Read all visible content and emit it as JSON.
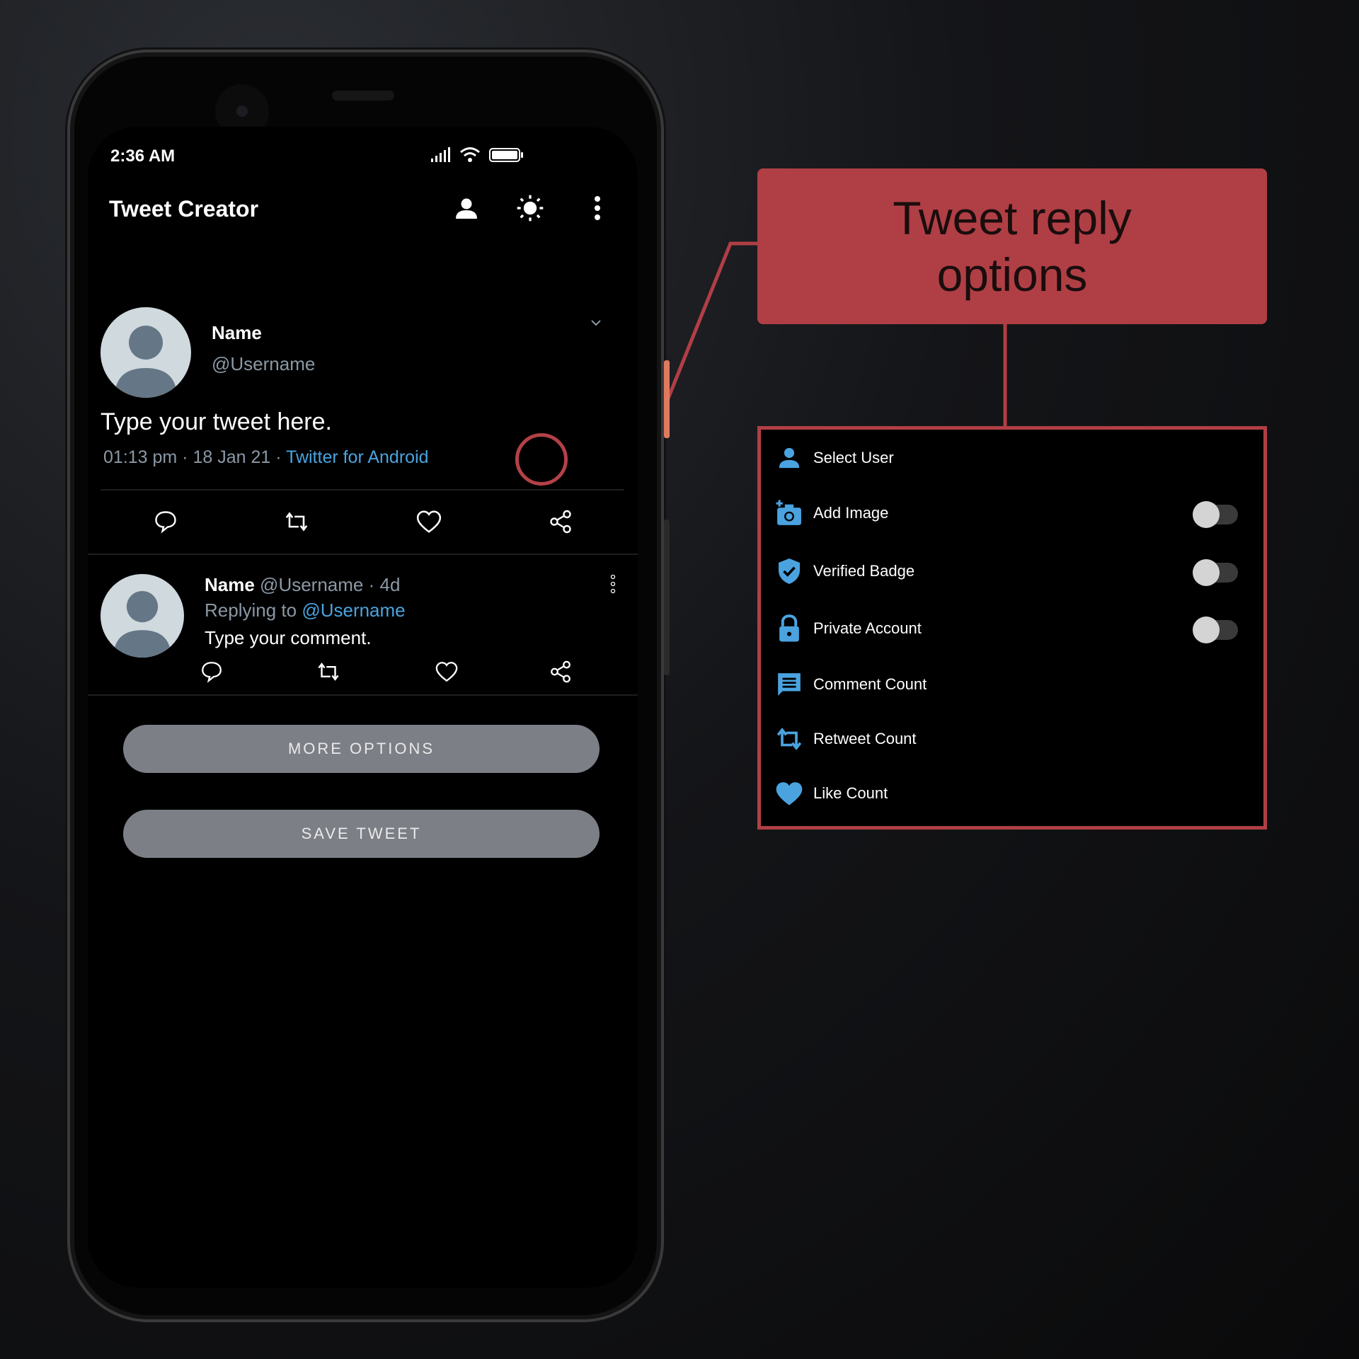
{
  "status_bar": {
    "time": "2:36 AM"
  },
  "appbar": {
    "title": "Tweet Creator",
    "icons": [
      "person-icon",
      "brightness-icon",
      "more-vert-icon"
    ]
  },
  "tweet": {
    "name": "Name",
    "username": "@Username",
    "text": "Type your tweet here.",
    "meta": "01:13 pm · 18 Jan 21 · ",
    "source": "Twitter for Android"
  },
  "reply": {
    "name": "Name",
    "meta": " @Username · 4d",
    "replying_prefix": "Replying to ",
    "replying_user": "@Username",
    "text": "Type your comment."
  },
  "buttons": {
    "more_options": "MORE OPTIONS",
    "save_tweet": "SAVE TWEET"
  },
  "callout": {
    "line1": "Tweet reply",
    "line2": "options"
  },
  "options": [
    {
      "label": "Select User",
      "icon": "person-icon",
      "has_toggle": false
    },
    {
      "label": "Add Image",
      "icon": "add-photo-icon",
      "has_toggle": true,
      "on": false
    },
    {
      "label": "Verified Badge",
      "icon": "verified-shield-icon",
      "has_toggle": true,
      "on": false
    },
    {
      "label": "Private Account",
      "icon": "lock-icon",
      "has_toggle": true,
      "on": false
    },
    {
      "label": "Comment Count",
      "icon": "comment-icon",
      "has_toggle": false
    },
    {
      "label": "Retweet Count",
      "icon": "retweet-icon",
      "has_toggle": false
    },
    {
      "label": "Like Count",
      "icon": "heart-icon",
      "has_toggle": false
    }
  ],
  "colors": {
    "accent_blue": "#4aa3df",
    "callout_red": "#b03f45",
    "button_gray": "#7c7f86"
  }
}
